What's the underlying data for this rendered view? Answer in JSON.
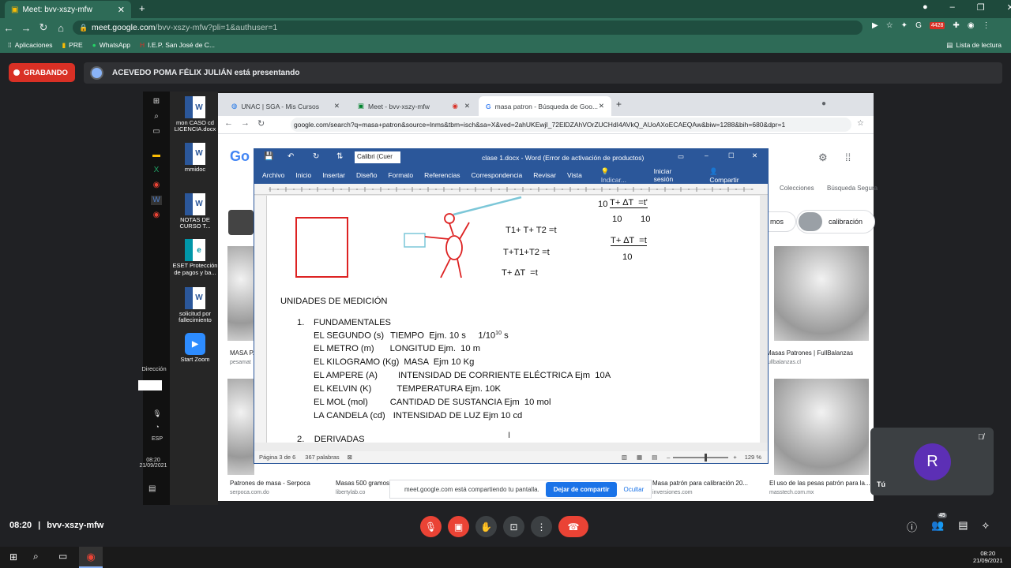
{
  "browser": {
    "tab_title": "Meet: bvv-xszy-mfw",
    "url_host": "meet.google.com",
    "url_path": "/bvv-xszy-mfw?pli=1&authuser=1",
    "bookmarks": [
      "Aplicaciones",
      "PRE",
      "WhatsApp",
      "I.E.P. San José de C..."
    ],
    "reading_list": "Lista de lectura",
    "badge": "4428"
  },
  "meet": {
    "recording_label": "GRABANDO",
    "presenting_label": "ACEVEDO POMA FÉLIX JULIÁN está presentando",
    "meeting_time": "08:20",
    "meeting_code": "bvv-xszy-mfw",
    "participants_count": "45",
    "self_initial": "R",
    "self_label": "Tú",
    "share_notice": "meet.google.com está compartiendo tu pantalla.",
    "stop_share": "Dejar de compartir",
    "hide": "Ocultar"
  },
  "desktop": {
    "icons": [
      "mon CASO cd LICENCIA.docx",
      "mmidoc",
      "NOTAS DE CURSO T...",
      "ESET Protección de pagos y ba...",
      "solicitud por fallecimiento",
      "Start Zoom"
    ],
    "direction_label": "Dirección",
    "lang": "ESP",
    "time": "08:20",
    "date": "21/09/2021"
  },
  "inner_browser": {
    "tabs": [
      "UNAC | SGA - Mis Cursos",
      "Meet - bvv-xszy-mfw",
      "masa patron - Búsqueda de Goo..."
    ],
    "url": "google.com/search?q=masa+patron&source=lnms&tbm=isch&sa=X&ved=2ahUKEwjI_72ElDZAhVOrZUCHdI4AVkQ_AUoAXoECAEQAw&biw=1288&bih=680&dpr=1",
    "filters": [
      "Colecciones",
      "Búsqueda Segura"
    ],
    "chips": [
      "mos",
      "calibración"
    ],
    "results": [
      {
        "title": "Patrones de masa - Serpoca",
        "source": "serpoca.com.do"
      },
      {
        "title": "Masas 500 gramos",
        "source": "libertylab.co"
      },
      {
        "title": "Masa patrón para calibración 20...",
        "source": "inversiones.com"
      },
      {
        "title": "El uso de las pesas patrón para la...",
        "source": "masstech.com.mx"
      },
      {
        "title": "MASA P...",
        "source": "pesamat"
      },
      {
        "title": "Masas Patrones | FullBalanzas",
        "source": "fullbalanzas.cl"
      }
    ]
  },
  "word": {
    "title": "clase 1.docx - Word (Error de activación de productos)",
    "font": "Calibri (Cuer",
    "menu": [
      "Archivo",
      "Inicio",
      "Insertar",
      "Diseño",
      "Formato",
      "Referencias",
      "Correspondencia",
      "Revisar",
      "Vista",
      "Indicar..."
    ],
    "signin": "Iniciar sesión",
    "share": "Compartir",
    "status_page": "Página 3 de 6",
    "status_words": "367 palabras",
    "zoom": "129 %",
    "formulas": {
      "f1": "T1+ T+ T2 =t",
      "f2": "T+T1+T2 =t",
      "f3": "T+ ∆T  =t",
      "f4_pre": "10",
      "f4_num": "T+ ∆T  =t'",
      "f4_den1": "10",
      "f4_den2": "10",
      "f5_num": "T+ ∆T  =t",
      "f5_den": "10"
    },
    "heading": "UNIDADES DE MEDICIÓN",
    "list_num": "1.",
    "list_title": "FUNDAMENTALES",
    "lines": [
      {
        "a": "EL SEGUNDO (s)",
        "b": "TIEMPO  Ejm. 10 s     1/10",
        "sup": "10",
        "c": " s"
      },
      {
        "a": "EL METRO (m)",
        "b": "LONGITUD Ejm.  10 m",
        "sup": "",
        "c": ""
      },
      {
        "a": "EL KILOGRAMO (Kg)",
        "b": "MASA  Ejm 10 Kg",
        "sup": "",
        "c": ""
      },
      {
        "a": "EL AMPERE (A)",
        "b": "INTENSIDAD DE CORRIENTE ELÉCTRICA Ejm  10A",
        "sup": "",
        "c": ""
      },
      {
        "a": "EL KELVIN (K)",
        "b": "TEMPERATURA Ejm. 10K",
        "sup": "",
        "c": ""
      },
      {
        "a": "EL MOL (mol)",
        "b": "CANTIDAD DE SUSTANCIA Ejm  10 mol",
        "sup": "",
        "c": ""
      },
      {
        "a": "LA CANDELA (cd)",
        "b": "INTENSIDAD DE LUZ Ejm 10 cd",
        "sup": "",
        "c": ""
      }
    ],
    "next_item": "2.    DERIVADAS"
  },
  "taskbar": {
    "time": "08:20",
    "date": "21/09/2021"
  }
}
